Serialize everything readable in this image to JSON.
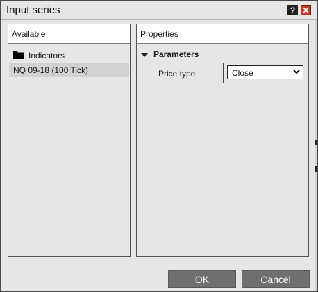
{
  "window": {
    "title": "Input series",
    "help_glyph": "?",
    "close_glyph": "✕"
  },
  "available": {
    "header": "Available",
    "items": [
      {
        "label": "Indicators",
        "icon": "folder-icon"
      },
      {
        "label": "NQ 09-18 (100 Tick)",
        "selected": true
      }
    ]
  },
  "properties": {
    "header": "Properties",
    "section": "Parameters",
    "price_type": {
      "label": "Price type",
      "value": "Close"
    }
  },
  "buttons": {
    "ok": "OK",
    "cancel": "Cancel"
  },
  "colors": {
    "close_button": "#c0392b",
    "button_bg": "#6f6f6f",
    "selected_row": "#d2d2d2"
  }
}
